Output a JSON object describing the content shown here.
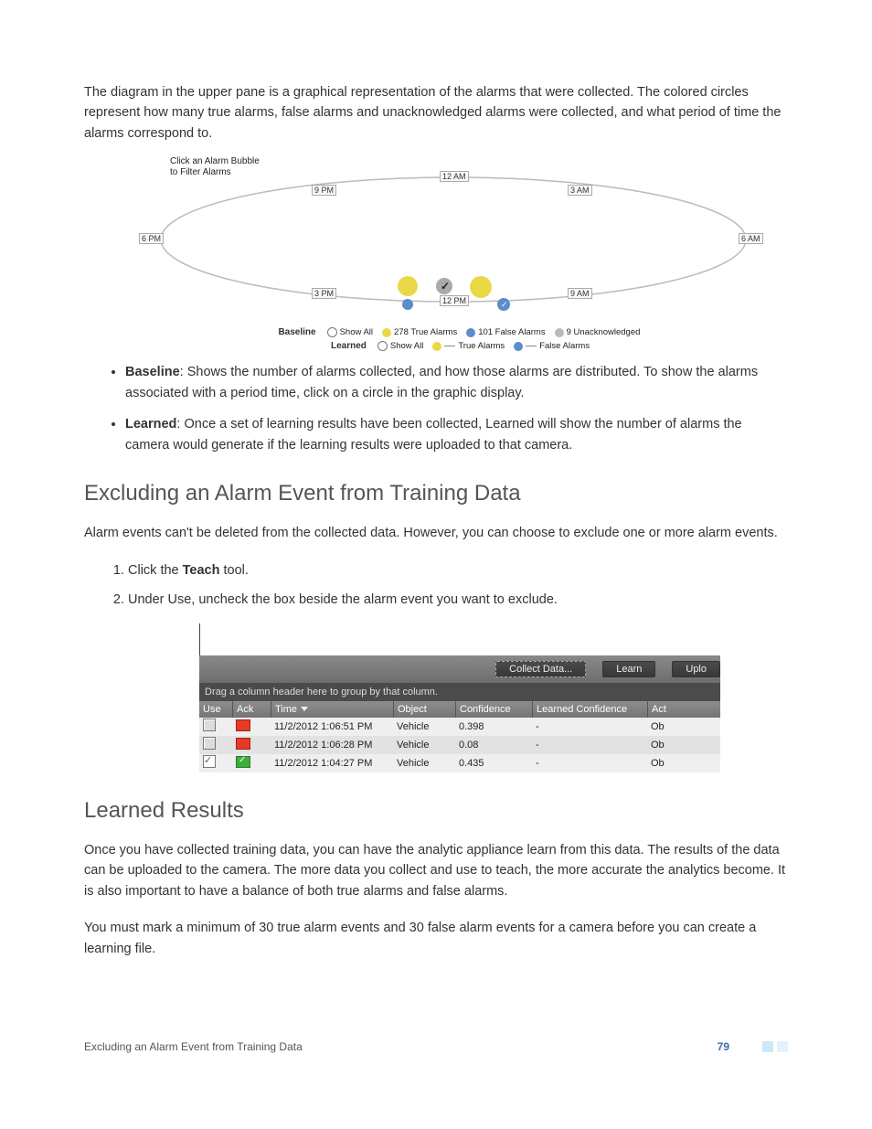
{
  "intro_paragraph": "The diagram in the upper pane is a graphical representation of the alarms that were collected. The colored circles represent how many true alarms, false alarms and unacknowledged alarms were collected, and what period of time the alarms correspond to.",
  "diagram": {
    "hint_line1": "Click an Alarm Bubble",
    "hint_line2": "to Filter Alarms",
    "times": {
      "t12am": "12 AM",
      "t3am": "3 AM",
      "t6am": "6 AM",
      "t9am": "9 AM",
      "t12pm": "12 PM",
      "t3pm": "3 PM",
      "t6pm": "6 PM",
      "t9pm": "9 PM"
    },
    "legend": {
      "baseline_label": "Baseline",
      "learned_label": "Learned",
      "show_all": "Show All",
      "true_alarms_count": "278 True Alarms",
      "false_alarms_count": "101 False Alarms",
      "unack_count": "9 Unacknowledged",
      "true_alarms_plain": "True Alarms",
      "false_alarms_plain": "False Alarms"
    }
  },
  "bullets": {
    "baseline_bold": "Baseline",
    "baseline_rest": ": Shows the number of alarms collected, and how those alarms are distributed. To show the alarms associated with a period time, click on a circle in the graphic display.",
    "learned_bold": "Learned",
    "learned_rest": ": Once a set of learning results have been collected, Learned will show the number of alarms the camera would generate if the learning results were uploaded to that camera."
  },
  "heading_excluding": "Excluding an Alarm Event from Training Data",
  "excluding_p": "Alarm events can't be deleted from the collected data. However, you can choose to exclude one or more alarm events.",
  "steps": {
    "s1_prefix": "Click the ",
    "s1_bold": "Teach",
    "s1_suffix": " tool.",
    "s2": "Under Use, uncheck the box beside the alarm event you want to exclude."
  },
  "table": {
    "buttons": {
      "collect": "Collect Data...",
      "learn": "Learn",
      "upload": "Uplo"
    },
    "group_hint": "Drag a column header here to group by that column.",
    "headers": {
      "use": "Use",
      "ack": "Ack",
      "time": "Time",
      "object": "Object",
      "confidence": "Confidence",
      "learned_conf": "Learned Confidence",
      "act": "Act"
    },
    "rows": [
      {
        "use_checked": false,
        "ack": "red",
        "time": "11/2/2012 1:06:51 PM",
        "object": "Vehicle",
        "confidence": "0.398",
        "lconf": "-",
        "act": "Ob"
      },
      {
        "use_checked": false,
        "ack": "red",
        "time": "11/2/2012 1:06:28 PM",
        "object": "Vehicle",
        "confidence": "0.08",
        "lconf": "-",
        "act": "Ob"
      },
      {
        "use_checked": true,
        "ack": "green",
        "time": "11/2/2012 1:04:27 PM",
        "object": "Vehicle",
        "confidence": "0.435",
        "lconf": "-",
        "act": "Ob"
      }
    ]
  },
  "heading_learned": "Learned Results",
  "learned_p1": "Once you have collected training data, you can have the analytic appliance learn from this data. The results of the data can be uploaded to the camera. The more data you collect and use to teach, the more accurate the analytics become. It is also important to have a balance of both true alarms and false alarms.",
  "learned_p2": "You must mark a minimum of 30 true alarm events and 30 false alarm events for a camera before you can create a learning file.",
  "footer": {
    "title": "Excluding an Alarm Event from Training Data",
    "page": "79"
  }
}
